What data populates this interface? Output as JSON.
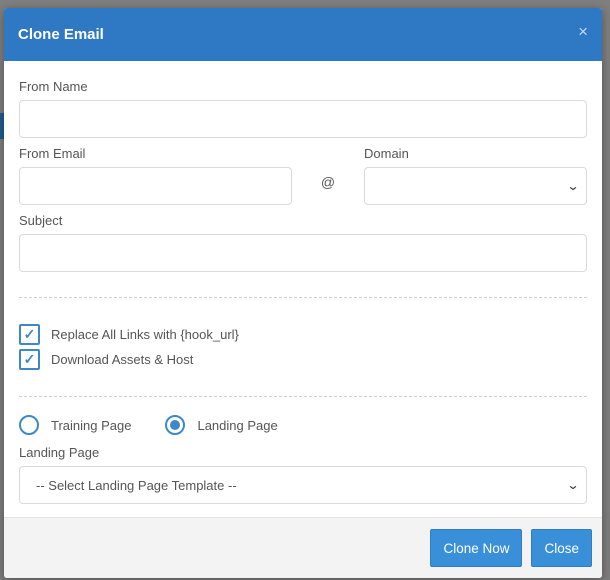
{
  "modal": {
    "title": "Clone Email",
    "close_glyph": "×"
  },
  "form": {
    "from_name_label": "From Name",
    "from_name_value": "",
    "from_email_label": "From Email",
    "from_email_value": "",
    "at_sign": "@",
    "domain_label": "Domain",
    "domain_value": "",
    "subject_label": "Subject",
    "subject_value": "",
    "checkboxes": [
      {
        "label": "Replace All Links with {hook_url}",
        "checked": true
      },
      {
        "label": "Download Assets & Host",
        "checked": true
      }
    ],
    "radios": [
      {
        "label": "Training Page",
        "selected": false
      },
      {
        "label": "Landing Page",
        "selected": true
      }
    ],
    "landing_page_label": "Landing Page",
    "landing_page_select": "-- Select Landing Page Template --"
  },
  "footer": {
    "clone_now_label": "Clone Now",
    "close_label": "Close"
  },
  "icons": {
    "check": "check-icon",
    "chevron": "chevron-down-icon",
    "close": "close-icon"
  },
  "colors": {
    "header": "#2f78c4",
    "accent": "#3e88c9",
    "button": "#3a8fd9"
  }
}
